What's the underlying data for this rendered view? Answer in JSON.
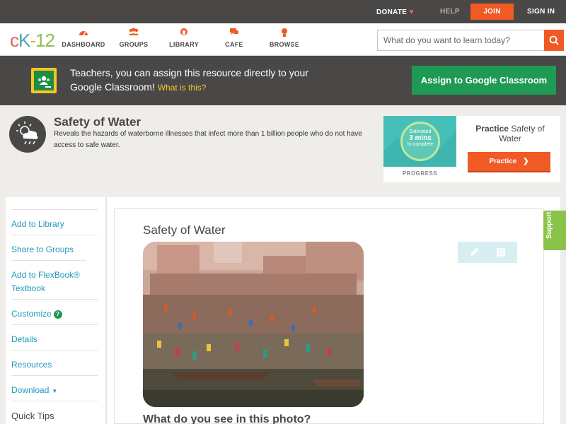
{
  "topbar": {
    "donate": "DONATE",
    "help": "HELP",
    "join": "JOIN",
    "signin": "SIGN IN"
  },
  "nav": {
    "items": [
      {
        "label": "DASHBOARD",
        "icon": "dashboard-icon"
      },
      {
        "label": "GROUPS",
        "icon": "groups-icon"
      },
      {
        "label": "LIBRARY",
        "icon": "library-icon"
      },
      {
        "label": "CAFE",
        "icon": "cafe-icon"
      },
      {
        "label": "BROWSE",
        "icon": "browse-icon"
      }
    ],
    "search_placeholder": "What do you want to learn today?"
  },
  "banner": {
    "text": "Teachers, you can assign this resource directly to your Google Classroom!",
    "what": "What is this?",
    "button": "Assign to Google Classroom"
  },
  "header": {
    "title": "Safety of Water",
    "description": "Reveals the hazards of waterborne illnesses that infect more than 1 billion people who do not have access to safe water."
  },
  "practice": {
    "estimated": "Estimated",
    "mins": "3 mins",
    "complete": "to complete",
    "progress_label": "PROGRESS",
    "title_bold": "Practice",
    "title_rest": "Safety of Water",
    "button": "Practice"
  },
  "sidebar": {
    "items": [
      "Add to Library",
      "Share to Groups",
      "Add to FlexBook® Textbook",
      "Customize",
      "Details",
      "Resources",
      "Download",
      "Quick Tips"
    ]
  },
  "content": {
    "title": "Safety of Water",
    "question": "What do you see in this photo?"
  },
  "support": "Support",
  "colors": {
    "brand_orange": "#f05a24",
    "dark_bar": "#4a4847",
    "google_green": "#1e9a55",
    "link_blue": "#1f9bbd",
    "support_green": "#8bc34a"
  }
}
